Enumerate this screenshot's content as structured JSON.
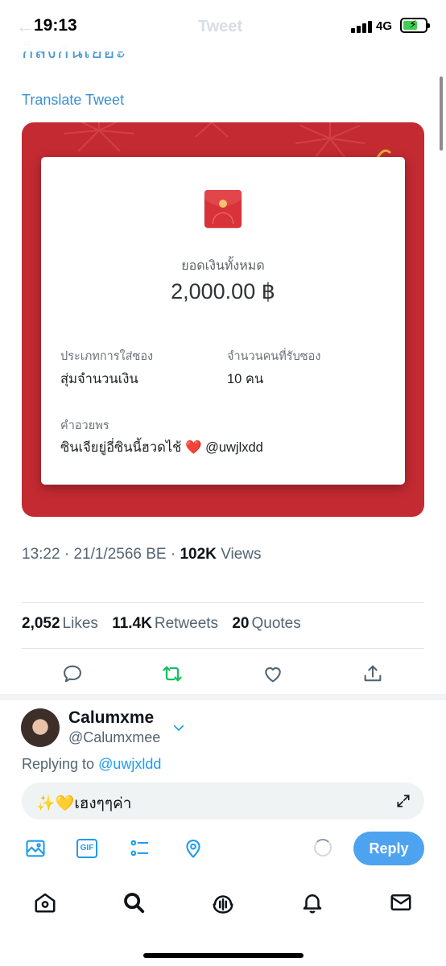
{
  "status_bar": {
    "time": "19:13",
    "network": "4G",
    "battery_level": 0.65
  },
  "nav": {
    "title": "Tweet"
  },
  "tweet": {
    "clipped_text": "ก็ลงกันเยอะ",
    "translate_link": "Translate Tweet",
    "red_packet": {
      "total_label": "ยอดเงินทั้งหมด",
      "total_value": "2,000.00 ฿",
      "type_label": "ประเภทการใส่ซอง",
      "type_value": "สุ่มจำนวนเงิน",
      "recipients_label": "จำนวนคนที่รับซอง",
      "recipients_value": "10 คน",
      "blessing_label": "คำอวยพร",
      "blessing_text": "ซินเจียยู่อี่ซินนี้ฮวดไช้",
      "blessing_emoji": "❤️",
      "blessing_mention": "@uwjlxdd"
    },
    "time": "13:22",
    "date": "21/1/2566 BE",
    "views_count": "102K",
    "views_label": "Views",
    "separator": "·",
    "stats": {
      "likes_count": "2,052",
      "likes_label": "Likes",
      "retweets_count": "11.4K",
      "retweets_label": "Retweets",
      "quotes_count": "20",
      "quotes_label": "Quotes"
    },
    "accent_retweet": "#17bf63"
  },
  "composer": {
    "display_name": "Calumxme",
    "handle": "@Calumxmee",
    "replying_prefix": "Replying to",
    "replying_to": "@uwjxldd",
    "reply_text": "✨💛เฮงๆๆค่า",
    "gif_label": "GIF",
    "reply_button": "Reply"
  },
  "colors": {
    "link": "#1d9bf0",
    "packet_red": "#c42a32",
    "reply_button": "#4da3f0"
  }
}
